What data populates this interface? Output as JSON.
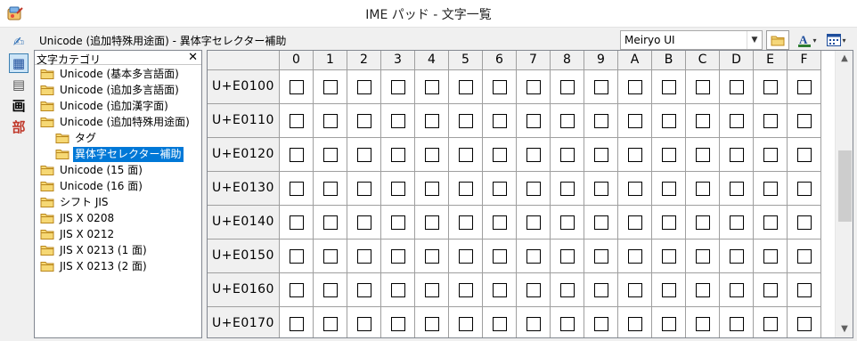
{
  "window": {
    "title": "IME パッド - 文字一覧",
    "app_icon": "ime-pad-app-icon"
  },
  "modebar": [
    {
      "name": "handwriting-mode-button",
      "icon": "pen-icon",
      "glyph": "✍",
      "active": false
    },
    {
      "name": "character-list-mode-button",
      "icon": "character-list-icon",
      "glyph": "▦",
      "active": true
    },
    {
      "name": "soft-keyboard-mode-button",
      "icon": "keyboard-icon",
      "glyph": "▤",
      "active": false
    },
    {
      "name": "stroke-count-mode-button",
      "icon": "stroke-count-icon",
      "glyph": "画",
      "active": false
    },
    {
      "name": "radical-mode-button",
      "icon": "radical-icon",
      "glyph": "部",
      "active": false
    }
  ],
  "header": {
    "subtitle": "Unicode (追加特殊用途面) - 異体字セレクター補助",
    "font_value": "Meiryo UI"
  },
  "category_panel": {
    "title": "文字カテゴリ",
    "close_glyph": "✕",
    "items": [
      {
        "label": "Unicode (基本多言語面)",
        "level": 0,
        "selected": false
      },
      {
        "label": "Unicode (追加多言語面)",
        "level": 0,
        "selected": false
      },
      {
        "label": "Unicode (追加漢字面)",
        "level": 0,
        "selected": false
      },
      {
        "label": "Unicode (追加特殊用途面)",
        "level": 0,
        "selected": false
      },
      {
        "label": "タグ",
        "level": 1,
        "selected": false
      },
      {
        "label": "異体字セレクター補助",
        "level": 1,
        "selected": true
      },
      {
        "label": "Unicode (15 面)",
        "level": 0,
        "selected": false
      },
      {
        "label": "Unicode (16 面)",
        "level": 0,
        "selected": false
      },
      {
        "label": "シフト JIS",
        "level": 0,
        "selected": false
      },
      {
        "label": "JIS X 0208",
        "level": 0,
        "selected": false
      },
      {
        "label": "JIS X 0212",
        "level": 0,
        "selected": false
      },
      {
        "label": "JIS X 0213 (1 面)",
        "level": 0,
        "selected": false
      },
      {
        "label": "JIS X 0213 (2 面)",
        "level": 0,
        "selected": false
      }
    ]
  },
  "grid": {
    "columns": [
      "0",
      "1",
      "2",
      "3",
      "4",
      "5",
      "6",
      "7",
      "8",
      "9",
      "A",
      "B",
      "C",
      "D",
      "E",
      "F"
    ],
    "rows": [
      "U+E0100",
      "U+E0110",
      "U+E0120",
      "U+E0130",
      "U+E0140",
      "U+E0150",
      "U+E0160",
      "U+E0170"
    ]
  },
  "scrollbar": {
    "up_glyph": "▲",
    "down_glyph": "▼"
  },
  "colors": {
    "selection": "#0078d7",
    "active_mode": "#cce4f7",
    "header_bg": "#f0f0f0"
  }
}
